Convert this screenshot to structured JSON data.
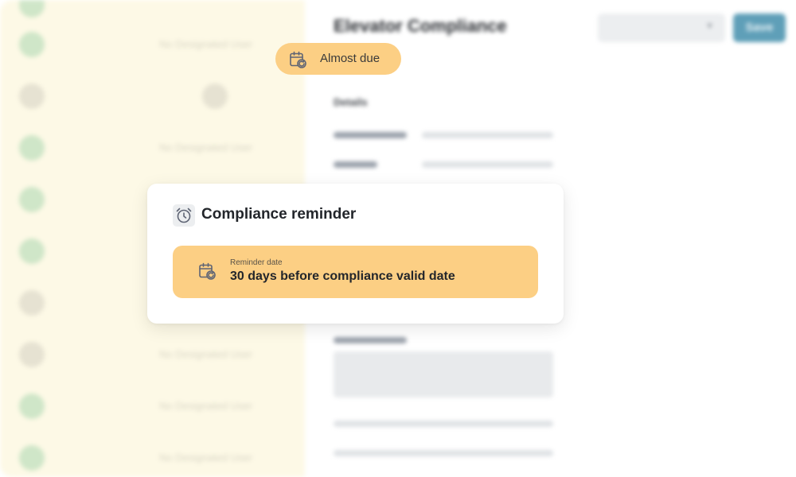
{
  "background": {
    "left_rows": [
      {
        "dot": "green",
        "ghost_text": "No Designated User"
      },
      {
        "dot": "gray",
        "ghost_text": ""
      },
      {
        "dot": "green",
        "ghost_text": "No Designated User"
      },
      {
        "dot": "green",
        "ghost_text": ""
      },
      {
        "dot": "green",
        "ghost_text": ""
      },
      {
        "dot": "gray",
        "ghost_text": ""
      },
      {
        "dot": "gray",
        "ghost_text": "No Designated User"
      },
      {
        "dot": "green",
        "ghost_text": "No Designated User"
      },
      {
        "dot": "green",
        "ghost_text": "No Designated User"
      }
    ],
    "page_title": "Elevator Compliance",
    "select_value": "",
    "save_label": "Save",
    "details_heading": "Details"
  },
  "status_pill": {
    "label": "Almost due",
    "icon": "calendar-refresh-icon"
  },
  "reminder_card": {
    "icon": "alarm-clock-icon",
    "title": "Compliance reminder",
    "caption": "Reminder date",
    "value": "30 days before compliance valid date",
    "value_icon": "calendar-refresh-icon"
  },
  "colors": {
    "accent_orange": "#fccf84",
    "left_panel_bg": "#fdf9e6",
    "save_button": "#5f9fb8",
    "icon_stroke": "#5e6474"
  }
}
